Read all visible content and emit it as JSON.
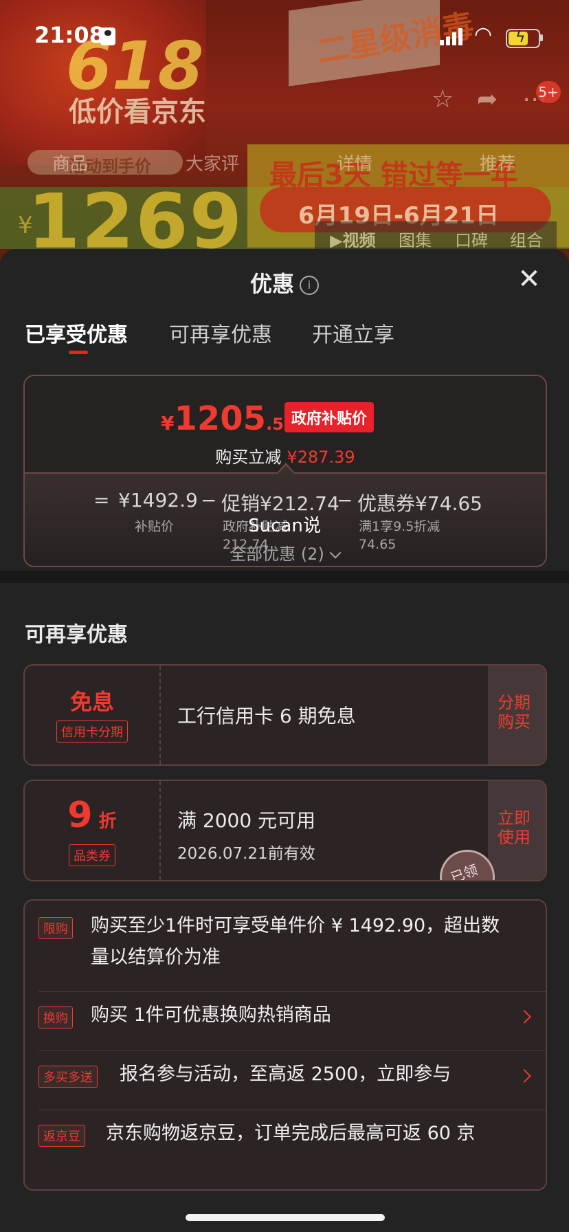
{
  "status_bar": {
    "time": "21:08"
  },
  "backdrop": {
    "promo_618": "618",
    "promo_sub": "低价看京东",
    "box_text": "二星级消毒",
    "banner_text": "最后3天 错过等一年",
    "date_pill": "6月19日-6月21日",
    "price": "1269",
    "price_currency": "¥",
    "hand_price_label": "活动到手价",
    "top_tabs": [
      "商品",
      "大家评",
      "详情",
      "推荐"
    ],
    "media_tabs": [
      "▶视频",
      "图集",
      "口碑",
      "组合"
    ],
    "badge": "5+"
  },
  "sheet": {
    "title": "优惠",
    "tabs": [
      "已享受优惠",
      "可再享优惠",
      "开通立享"
    ],
    "summary": {
      "final_currency": "¥",
      "final_int": "1205",
      "final_dec": ".51",
      "tag": "政府补贴价",
      "reduce_label": "购买立减",
      "reduce_amount": "¥287.39",
      "formula": {
        "eq": "=",
        "base_price": "¥1492.9",
        "minus1": "−",
        "promo": "促销¥212.74",
        "minus2": "−",
        "coupon": "优惠券¥74.65",
        "base_label": "补贴价",
        "promo_label_1": "政府补贴减",
        "promo_label_2": "212.74",
        "coupon_label_1": "满1享9.5折减",
        "coupon_label_2": "74.65"
      }
    },
    "watermark": "Sucan说",
    "all_offers": "全部优惠 (2)",
    "section_title": "可再享优惠",
    "offers": [
      {
        "left_title": "免息",
        "left_tag": "信用卡分期",
        "main": "工行信用卡 6 期免息",
        "button": "分期购买"
      },
      {
        "left_num": "9",
        "left_unit": "折",
        "left_tag": "品类券",
        "main": "满 2000 元可用",
        "sub": "2026.07.21前有效",
        "button": "立即使用",
        "stamp": "已领"
      }
    ],
    "rules": [
      {
        "tag": "限购",
        "text_1": "购买至少1件时可享受单件价 ¥ 1492.90，超出数",
        "text_2": "量以结算价为准"
      },
      {
        "tag": "换购",
        "text_1": "购买 1件可优惠换购热销商品"
      },
      {
        "tag": "多买多送",
        "text_1": "报名参与活动，至高返 2500，立即参与"
      },
      {
        "tag": "返京豆",
        "text_1": "京东购物返京豆，订单完成后最高可返 60 京"
      }
    ]
  }
}
